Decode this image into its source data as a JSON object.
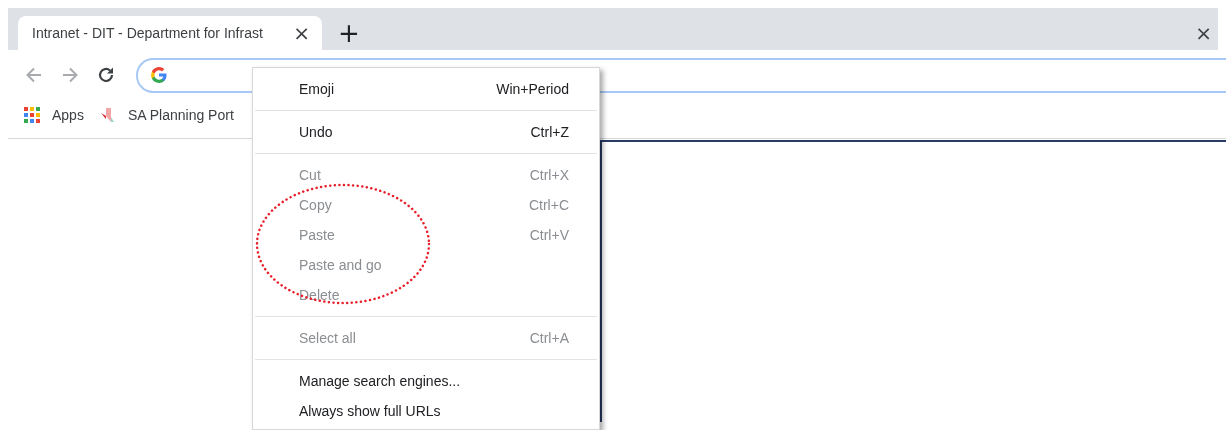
{
  "tabs": [
    {
      "title": "Intranet - DIT - Department for Infrast",
      "selected": true,
      "close": "×"
    }
  ],
  "new_tab": "+",
  "window_close": "×",
  "toolbar": {
    "back_disabled": true,
    "forward_disabled": true
  },
  "address_bar": {
    "focused": true
  },
  "bookmarks": [
    {
      "label": "Apps",
      "kind": "apps"
    },
    {
      "label": "SA Planning Port",
      "kind": "site"
    }
  ],
  "context_menu": {
    "sections": [
      [
        {
          "label": "Emoji",
          "shortcut": "Win+Period",
          "disabled": false
        }
      ],
      [
        {
          "label": "Undo",
          "shortcut": "Ctrl+Z",
          "disabled": false
        }
      ],
      [
        {
          "label": "Cut",
          "shortcut": "Ctrl+X",
          "disabled": true
        },
        {
          "label": "Copy",
          "shortcut": "Ctrl+C",
          "disabled": true
        },
        {
          "label": "Paste",
          "shortcut": "Ctrl+V",
          "disabled": true
        },
        {
          "label": "Paste and go",
          "disabled": true
        },
        {
          "label": "Delete",
          "disabled": true
        }
      ],
      [
        {
          "label": "Select all",
          "shortcut": "Ctrl+A",
          "disabled": true
        }
      ],
      [
        {
          "label": "Manage search engines...",
          "disabled": false
        },
        {
          "label": "Always show full URLs",
          "disabled": false
        }
      ]
    ]
  },
  "annotation": {
    "kind": "dotted-ellipse",
    "color": "#e8202a"
  }
}
